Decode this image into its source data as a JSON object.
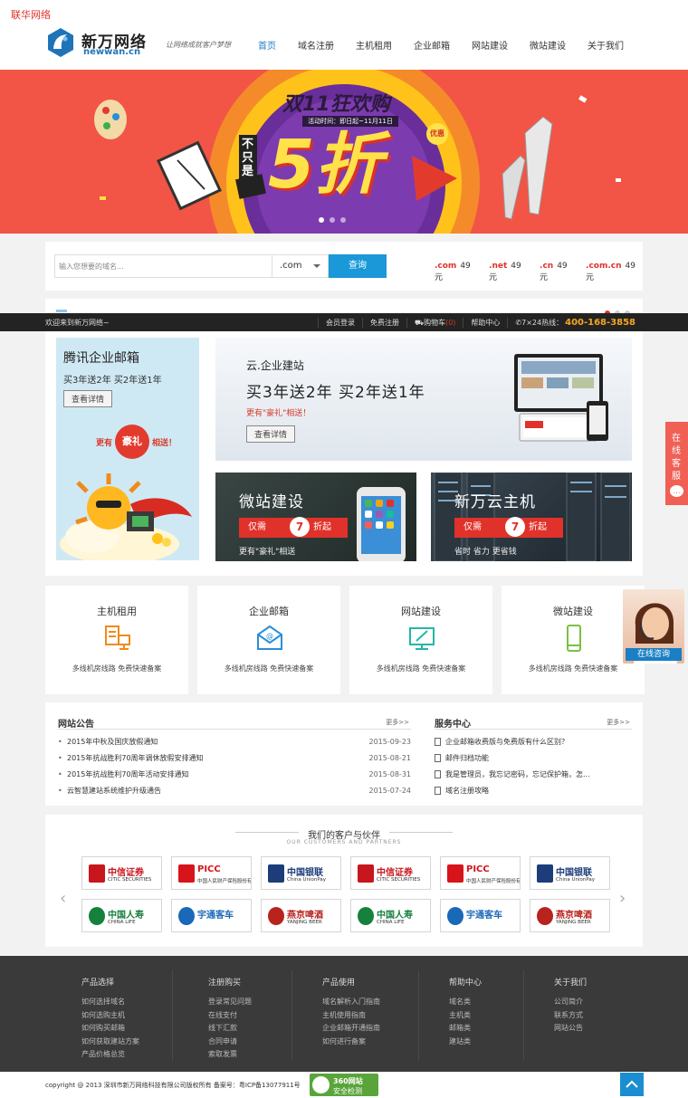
{
  "site_label": "联华网络",
  "logo": {
    "name_cn": "新万网络",
    "name_en": "newwan.cn"
  },
  "slogan": "让网络成就客户梦想",
  "nav": [
    {
      "label": "首页",
      "active": true
    },
    {
      "label": "域名注册"
    },
    {
      "label": "主机租用"
    },
    {
      "label": "企业邮箱"
    },
    {
      "label": "网站建设"
    },
    {
      "label": "微站建设"
    },
    {
      "label": "关于我们"
    }
  ],
  "banner": {
    "headline": "双11狂欢购",
    "activity_time": "活动时间：即日起~11月11日",
    "not_only": "不只是",
    "discount": "5折",
    "tag": "优惠",
    "slide_count": 3,
    "active_slide": 0
  },
  "domain_search": {
    "placeholder": "输入您想要的域名...",
    "tld_selected": ".com",
    "button": "查询",
    "prices": [
      {
        "ext": ".com",
        "price": "49元"
      },
      {
        "ext": ".net",
        "price": "49元"
      },
      {
        "ext": ".cn",
        "price": "49元"
      },
      {
        "ext": ".com.cn",
        "price": "49元"
      }
    ]
  },
  "topbar": {
    "welcome": "欢迎来到新万网络~",
    "links": [
      "会员登录",
      "免费注册",
      "购物车",
      "帮助中心"
    ],
    "cart_count": "(0)",
    "hotline_label": "7×24热线：",
    "hotline": "400-168-3858"
  },
  "promos": {
    "mail": {
      "title": "腾讯企业邮箱",
      "subtitle": "买3年送2年  买2年送1年",
      "button": "查看详情",
      "more": "更有",
      "gift": "豪礼",
      "more_tail": "相送！"
    },
    "site": {
      "title": "云.企业建站",
      "subtitle": "买3年送2年  买2年送1年",
      "gift_note": "更有\"豪礼\"相送！",
      "button": "查看详情"
    },
    "wei": {
      "title": "微站建设",
      "tag_left": "仅需",
      "tag_num": "7",
      "tag_right": "折起",
      "note": "更有\"豪礼\"相送"
    },
    "cloud": {
      "title": "新万云主机",
      "tag_left": "仅需",
      "tag_num": "7",
      "tag_right": "折起",
      "note": "省时 省力 更省钱"
    }
  },
  "services": [
    {
      "title": "主机租用",
      "desc": "多线机房线路  免费快速备案",
      "icon": "server-icon"
    },
    {
      "title": "企业邮箱",
      "desc": "多线机房线路  免费快速备案",
      "icon": "mail-icon"
    },
    {
      "title": "网站建设",
      "desc": "多线机房线路  免费快速备案",
      "icon": "design-icon"
    },
    {
      "title": "微站建设",
      "desc": "多线机房线路  免费快速备案",
      "icon": "mobile-icon"
    }
  ],
  "float": {
    "tab": "在线客服",
    "avatar_label": "在线咨询"
  },
  "notices": {
    "title": "网站公告",
    "more": "更多>>",
    "items": [
      {
        "title": "2015年中秋及国庆放假通知",
        "date": "2015-09-23"
      },
      {
        "title": "2015年抗战胜利70周年调休放假安排通知",
        "date": "2015-08-21"
      },
      {
        "title": "2015年抗战胜利70周年活动安排通知",
        "date": "2015-08-31"
      },
      {
        "title": "云智慧建站系统维护升级通告",
        "date": "2015-07-24"
      }
    ]
  },
  "service_center": {
    "title": "服务中心",
    "more": "更多>>",
    "items": [
      "企业邮箱收费版与免费版有什么区别？",
      "邮件归档功能",
      "我是管理员，我忘记密码，忘记保护箱，怎...",
      "域名注册攻略"
    ]
  },
  "partners": {
    "title": "我们的客户与伙伴",
    "subtitle": "OUR CUSTOMERS AND PARTNERS",
    "row1": [
      {
        "name": "中信证券",
        "en": "CITIC SECURITIES",
        "color": "#c8161d"
      },
      {
        "name": "PICC",
        "en": "中国人民财产保险股份有限公司",
        "color": "#d7141a"
      },
      {
        "name": "中国银联",
        "en": "China UnionPay",
        "color": "#1c3d7a"
      },
      {
        "name": "中信证券",
        "en": "CITIC SECURITIES",
        "color": "#c8161d"
      },
      {
        "name": "PICC",
        "en": "中国人民财产保险股份有限公司",
        "color": "#d7141a"
      },
      {
        "name": "中国银联",
        "en": "China UnionPay",
        "color": "#1c3d7a"
      }
    ],
    "row2": [
      {
        "name": "中国人寿",
        "en": "CHINA LIFE",
        "color": "#16803d"
      },
      {
        "name": "宇通客车",
        "en": "",
        "color": "#1a68b8"
      },
      {
        "name": "燕京啤酒",
        "en": "YANJING BEER",
        "color": "#b8231e"
      },
      {
        "name": "中国人寿",
        "en": "CHINA LIFE",
        "color": "#16803d"
      },
      {
        "name": "宇通客车",
        "en": "",
        "color": "#1a68b8"
      },
      {
        "name": "燕京啤酒",
        "en": "YANJING BEER",
        "color": "#b8231e"
      }
    ]
  },
  "footer": [
    {
      "title": "产品选择",
      "items": [
        "如何选择域名",
        "如何选购主机",
        "如何购买邮箱",
        "如何获取建站方案",
        "产品价格总览"
      ]
    },
    {
      "title": "注册购买",
      "items": [
        "登录常见问题",
        "在线支付",
        "线下汇款",
        "合同申请",
        "索取发票"
      ]
    },
    {
      "title": "产品使用",
      "items": [
        "域名解析入门指南",
        "主机使用指南",
        "企业邮箱开通指南",
        "如何进行备案"
      ]
    },
    {
      "title": "帮助中心",
      "items": [
        "域名类",
        "主机类",
        "邮箱类",
        "建站类"
      ]
    },
    {
      "title": "关于我们",
      "items": [
        "公司简介",
        "联系方式",
        "网站公告"
      ]
    }
  ],
  "copyright": "copyright @ 2013 深圳市新万网络科技有限公司版权所有 备案号：粤ICP备13077911号",
  "badge_360": {
    "line1": "360网站",
    "line2": "安全检测"
  },
  "colors": {
    "accent": "#1a98d8",
    "red": "#e0322a",
    "footer_bg": "#3a3a3a"
  }
}
